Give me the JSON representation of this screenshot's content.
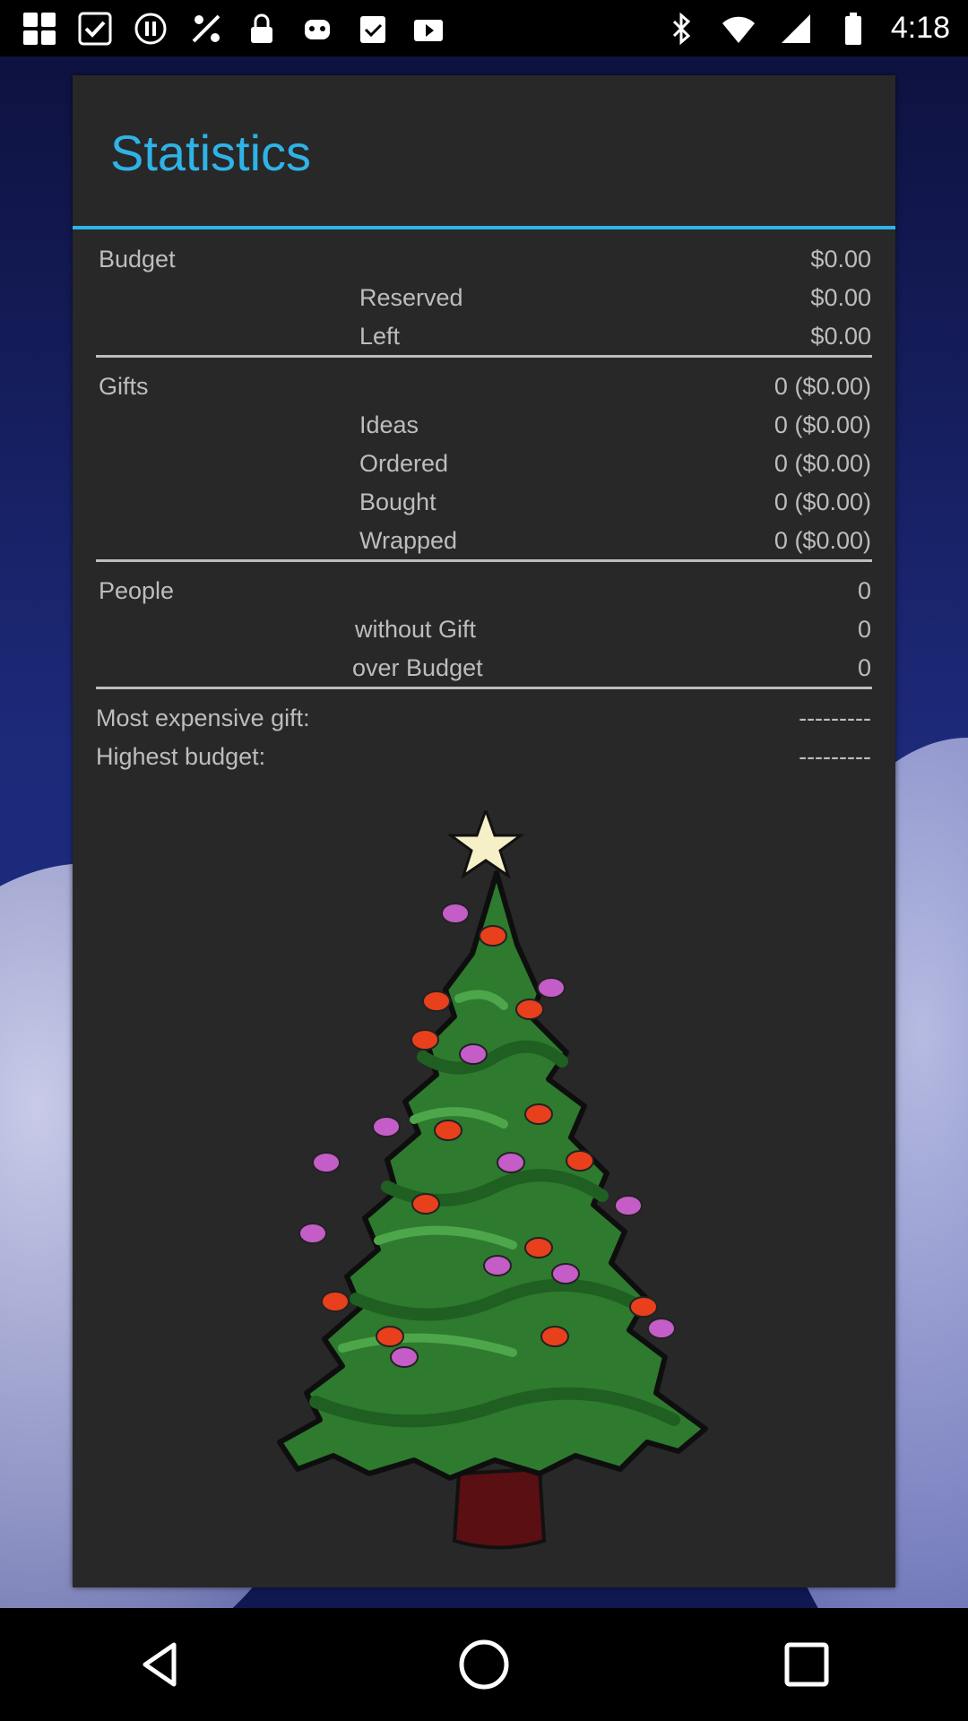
{
  "status_bar": {
    "time": "4:18",
    "left_icons": [
      "grid-icon",
      "check-square-icon",
      "pause-circle-icon",
      "signal-tools-icon",
      "lock-icon",
      "robot-icon",
      "clipboard-check-icon",
      "play-store-icon"
    ],
    "right_icons": [
      "bluetooth-icon",
      "wifi-icon",
      "signal-icon",
      "battery-icon"
    ]
  },
  "dialog": {
    "title": "Statistics",
    "accent_color": "#2fb3e6",
    "budget": {
      "label": "Budget",
      "value": "$0.00",
      "reserved_label": "Reserved",
      "reserved_value": "$0.00",
      "left_label": "Left",
      "left_value": "$0.00"
    },
    "gifts": {
      "label": "Gifts",
      "value": "0 ($0.00)",
      "ideas_label": "Ideas",
      "ideas_value": "0 ($0.00)",
      "ordered_label": "Ordered",
      "ordered_value": "0 ($0.00)",
      "bought_label": "Bought",
      "bought_value": "0 ($0.00)",
      "wrapped_label": "Wrapped",
      "wrapped_value": "0 ($0.00)"
    },
    "people": {
      "label": "People",
      "value": "0",
      "without_gift_label": "without Gift",
      "without_gift_value": "0",
      "over_budget_label": "over Budget",
      "over_budget_value": "0"
    },
    "extras": {
      "most_expensive_label": "Most expensive gift:",
      "most_expensive_value": "---------",
      "highest_budget_label": "Highest budget:",
      "highest_budget_value": "---------"
    },
    "illustration": "christmas-tree"
  },
  "nav_bar": {
    "buttons": [
      "back-icon",
      "home-icon",
      "recents-icon"
    ]
  }
}
